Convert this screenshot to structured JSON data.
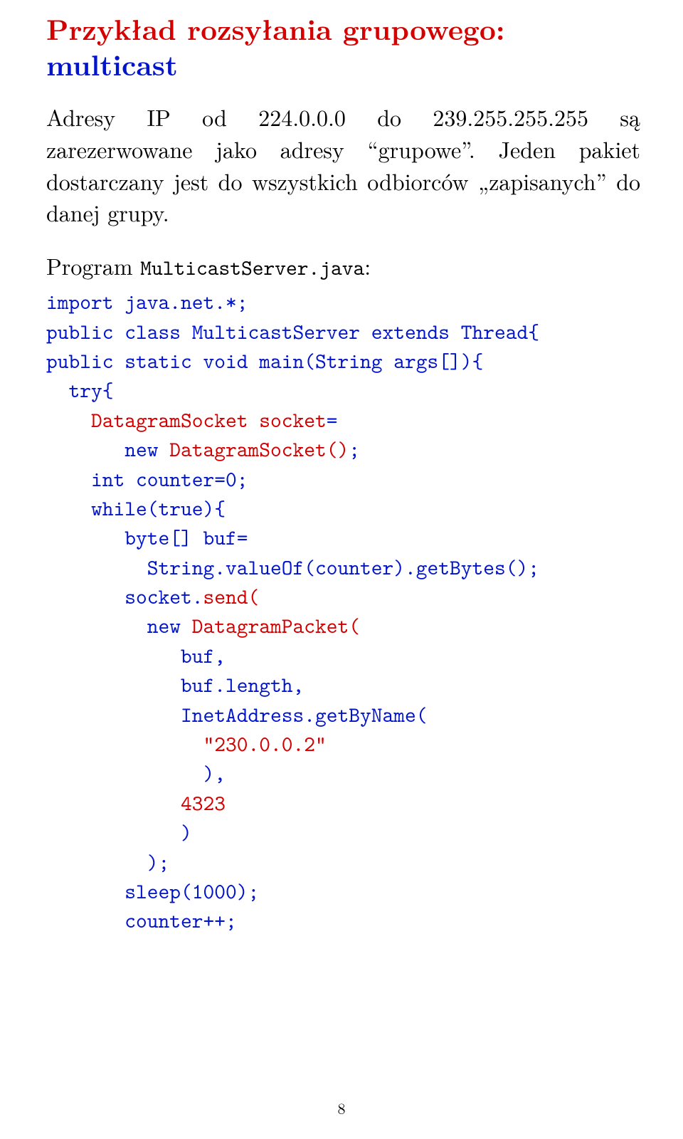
{
  "title": {
    "red": "Przykład rozsyłania grupowego: ",
    "blue": "multicast"
  },
  "para1_a": "Adresy IP od 224.0.0.0 do 239.255.255.255 są zarezerwowane jako adresy “grupowe”. Jeden pakiet dostarczany jest do wszystkich odbiorców „zapisanych” do danej grupy.",
  "program_intro_a": "Program ",
  "program_intro_file": "MulticastServer.java",
  "program_intro_b": ":",
  "code": {
    "l01a": "import java.net.*;",
    "l02a": "public class MulticastServer extends Thread{",
    "l03a": "public static void main(String args[]){",
    "l04a": "  ",
    "l04b": "try{",
    "l05a": "    ",
    "l05b": "DatagramSocket socket",
    "l05c": "=",
    "l06a": "       new ",
    "l06b": "DatagramSocket()",
    "l06c": ";",
    "l07a": "    int counter=0;",
    "l08a": "    while(true){",
    "l09a": "       byte[] buf=",
    "l10a": "         String.valueOf(counter).getBytes();",
    "l11a": "       socket.",
    "l11b": "send(",
    "l12a": "         new ",
    "l12b": "DatagramPacket(",
    "l13a": "            buf,",
    "l14a": "            buf.length,",
    "l15a": "            InetAddress.getByName(",
    "l16a": "              ",
    "l16b": "\"230.0.0.2\"",
    "l17a": "              ),",
    "l18a": "            ",
    "l18b": "4323",
    "l19a": "            )",
    "l20a": "         );",
    "l21a": "       sleep(1000);",
    "l22a": "       counter++;"
  },
  "pagenum": "8"
}
